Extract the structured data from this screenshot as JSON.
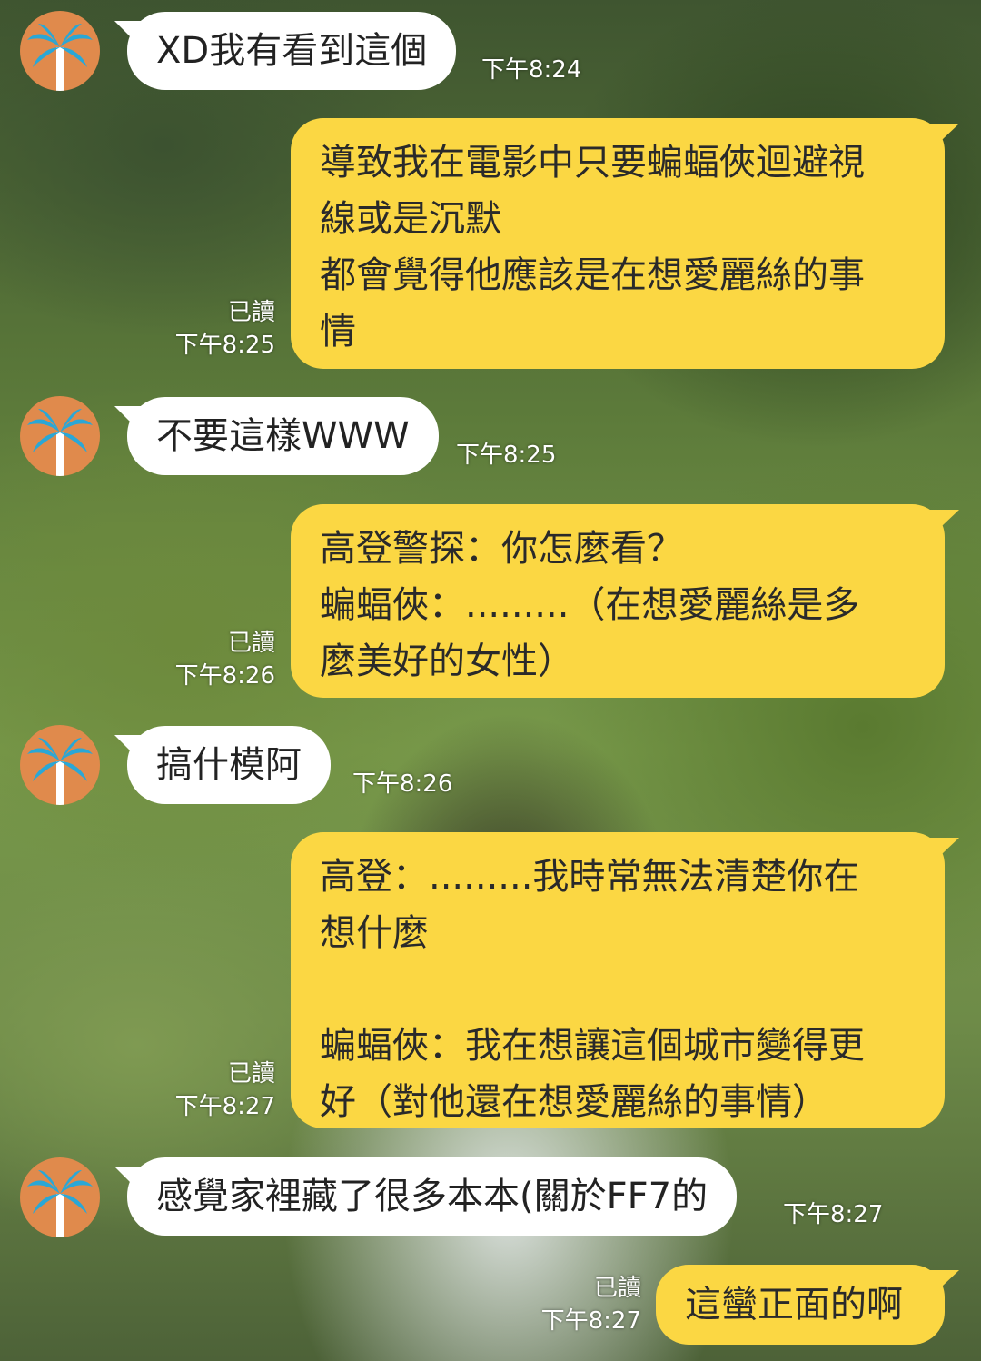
{
  "messages": [
    {
      "side": "in",
      "text": "XD我有看到這個",
      "time": "下午8:24"
    },
    {
      "side": "out",
      "text": "導致我在電影中只要蝙蝠俠迴避視\n線或是沉默\n都會覺得他應該是在想愛麗絲的事\n情",
      "read": "已讀",
      "time": "下午8:25"
    },
    {
      "side": "in",
      "text": "不要這樣WWW",
      "time": "下午8:25"
    },
    {
      "side": "out",
      "text": "高登警探：你怎麼看？\n蝙蝠俠：.........（在想愛麗絲是多\n麼美好的女性）",
      "read": "已讀",
      "time": "下午8:26"
    },
    {
      "side": "in",
      "text": "搞什模阿",
      "time": "下午8:26"
    },
    {
      "side": "out",
      "text": "高登：.........我時常無法清楚你在\n想什麼\n\n蝙蝠俠：我在想讓這個城市變得更\n好（對他還在想愛麗絲的事情）",
      "read": "已讀",
      "time": "下午8:27"
    },
    {
      "side": "in",
      "text": "感覺家裡藏了很多本本(關於FF7的",
      "time": "下午8:27"
    },
    {
      "side": "out",
      "text": "這蠻正面的啊",
      "read": "已讀",
      "time": "下午8:27"
    }
  ],
  "colors": {
    "outgoing_bubble": "#fbd743",
    "incoming_bubble": "#ffffff",
    "avatar_bg": "#e08a4c",
    "avatar_icon": "#2aa7d6"
  },
  "icons": {
    "avatar": "palm-tree-icon"
  }
}
